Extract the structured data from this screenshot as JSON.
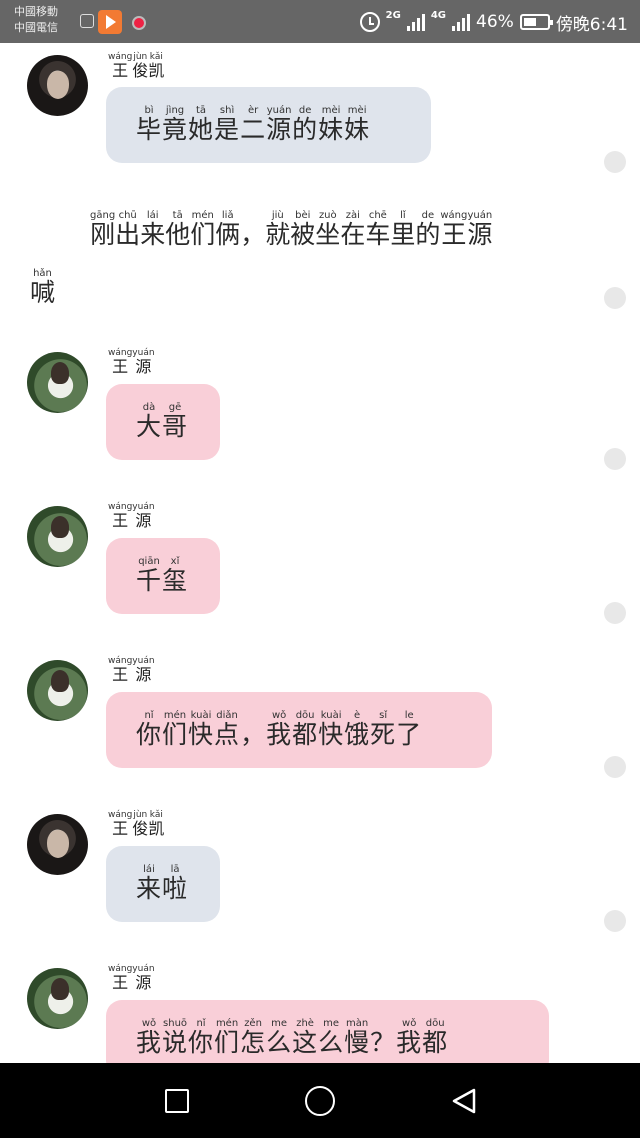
{
  "status_bar": {
    "carrier_1": "中國移動",
    "carrier_2": "中國電信",
    "network_1": "2G",
    "network_2": "4G",
    "battery_percent": "46%",
    "time": "傍晚6:41"
  },
  "messages": [
    {
      "type": "message",
      "sender": "kai",
      "name": [
        {
          "hz": "王",
          "py": "wáng"
        },
        {
          "hz": "俊",
          "py": "jùn"
        },
        {
          "hz": "凯",
          "py": "kǎi"
        }
      ],
      "text": [
        {
          "hz": "毕",
          "py": "bì"
        },
        {
          "hz": "竟",
          "py": "jìng"
        },
        {
          "hz": "她",
          "py": "tā"
        },
        {
          "hz": "是",
          "py": "shì"
        },
        {
          "hz": "二",
          "py": "èr"
        },
        {
          "hz": "源",
          "py": "yuán"
        },
        {
          "hz": "的",
          "py": "de"
        },
        {
          "hz": "妹",
          "py": "mèi"
        },
        {
          "hz": "妹",
          "py": "mèi"
        }
      ]
    },
    {
      "type": "narration",
      "text": [
        {
          "hz": "刚",
          "py": "gāng"
        },
        {
          "hz": "出",
          "py": "chū"
        },
        {
          "hz": "来",
          "py": "lái"
        },
        {
          "hz": "他",
          "py": "tā"
        },
        {
          "hz": "们",
          "py": "mén"
        },
        {
          "hz": "俩",
          "py": "liǎ"
        },
        {
          "hz": "，",
          "py": ""
        },
        {
          "hz": "就",
          "py": "jiù"
        },
        {
          "hz": "被",
          "py": "bèi"
        },
        {
          "hz": "坐",
          "py": "zuò"
        },
        {
          "hz": "在",
          "py": "zài"
        },
        {
          "hz": "车",
          "py": "chē"
        },
        {
          "hz": "里",
          "py": "lǐ"
        },
        {
          "hz": "的",
          "py": "de"
        },
        {
          "hz": "王",
          "py": "wáng"
        },
        {
          "hz": "源",
          "py": "yuán"
        }
      ]
    },
    {
      "type": "narration2",
      "text": [
        {
          "hz": "喊",
          "py": "hǎn"
        }
      ]
    },
    {
      "type": "message",
      "sender": "yuan",
      "name": [
        {
          "hz": "王",
          "py": "wáng"
        },
        {
          "hz": "源",
          "py": "yuán"
        }
      ],
      "text": [
        {
          "hz": "大",
          "py": "dà"
        },
        {
          "hz": "哥",
          "py": "gē"
        }
      ]
    },
    {
      "type": "message",
      "sender": "yuan",
      "name": [
        {
          "hz": "王",
          "py": "wáng"
        },
        {
          "hz": "源",
          "py": "yuán"
        }
      ],
      "text": [
        {
          "hz": "千",
          "py": "qiān"
        },
        {
          "hz": "玺",
          "py": "xǐ"
        }
      ]
    },
    {
      "type": "message",
      "sender": "yuan",
      "name": [
        {
          "hz": "王",
          "py": "wáng"
        },
        {
          "hz": "源",
          "py": "yuán"
        }
      ],
      "text": [
        {
          "hz": "你",
          "py": "nǐ"
        },
        {
          "hz": "们",
          "py": "mén"
        },
        {
          "hz": "快",
          "py": "kuài"
        },
        {
          "hz": "点",
          "py": "diǎn"
        },
        {
          "hz": "，",
          "py": ""
        },
        {
          "hz": "我",
          "py": "wǒ"
        },
        {
          "hz": "都",
          "py": "dōu"
        },
        {
          "hz": "快",
          "py": "kuài"
        },
        {
          "hz": "饿",
          "py": "è"
        },
        {
          "hz": "死",
          "py": "sǐ"
        },
        {
          "hz": "了",
          "py": "le"
        }
      ]
    },
    {
      "type": "message",
      "sender": "kai",
      "name": [
        {
          "hz": "王",
          "py": "wáng"
        },
        {
          "hz": "俊",
          "py": "jùn"
        },
        {
          "hz": "凯",
          "py": "kǎi"
        }
      ],
      "text": [
        {
          "hz": "来",
          "py": "lái"
        },
        {
          "hz": "啦",
          "py": "lā"
        }
      ]
    },
    {
      "type": "message",
      "sender": "yuan",
      "name": [
        {
          "hz": "王",
          "py": "wáng"
        },
        {
          "hz": "源",
          "py": "yuán"
        }
      ],
      "text": [
        {
          "hz": "我",
          "py": "wǒ"
        },
        {
          "hz": "说",
          "py": "shuō"
        },
        {
          "hz": "你",
          "py": "nǐ"
        },
        {
          "hz": "们",
          "py": "mén"
        },
        {
          "hz": "怎",
          "py": "zěn"
        },
        {
          "hz": "么",
          "py": "me"
        },
        {
          "hz": "这",
          "py": "zhè"
        },
        {
          "hz": "么",
          "py": "me"
        },
        {
          "hz": "慢",
          "py": "màn"
        },
        {
          "hz": "？",
          "py": ""
        },
        {
          "hz": "我",
          "py": "wǒ"
        },
        {
          "hz": "都",
          "py": "dōu"
        }
      ]
    }
  ],
  "colors": {
    "bubble_kai": "#dfe4ec",
    "bubble_yuan": "#f9cfd8",
    "status_bar": "#666666",
    "nav_bar": "#000000"
  },
  "nav": {
    "back_icon": "triangle-back-icon",
    "home_icon": "circle-home-icon",
    "recent_icon": "square-recent-icon"
  }
}
